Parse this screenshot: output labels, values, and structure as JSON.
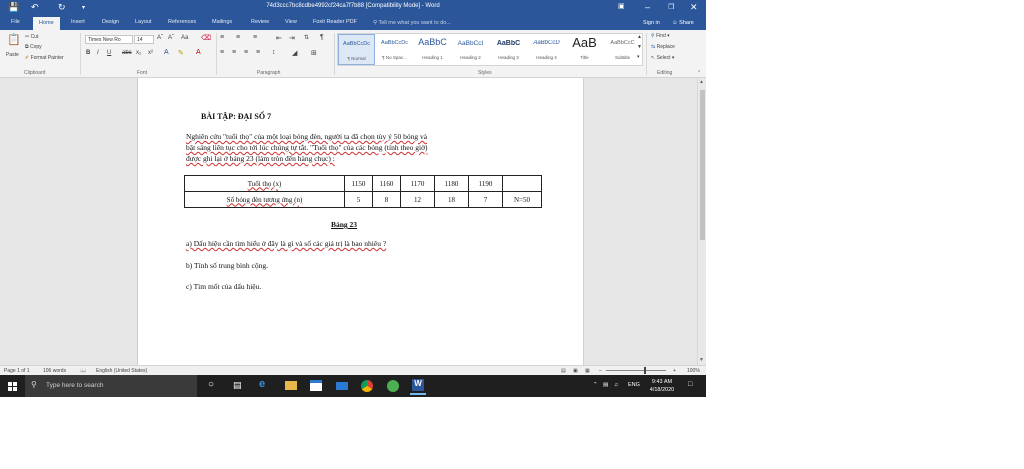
{
  "titlebar": {
    "title": "74d3ccc7bc8cdbe4992cf24ca7f7b88 [Compatibility Mode]  -  Word",
    "qa_save_icon": "save-icon",
    "qa_undo_icon": "undo-icon",
    "qa_redo_icon": "redo-icon",
    "qa_customize_icon": "chevron-down-icon",
    "window_controls": [
      "ribbon-options-icon",
      "minimize-icon",
      "restore-icon",
      "close-icon"
    ]
  },
  "tabs": [
    "File",
    "Home",
    "Insert",
    "Design",
    "Layout",
    "References",
    "Mailings",
    "Review",
    "View",
    "Foxit Reader PDF"
  ],
  "active_tab": "Home",
  "tell_me_placeholder": "Tell me what you want to do...",
  "signin_label": "Sign in",
  "share_label": "Share",
  "ribbon": {
    "clipboard": {
      "paste": "Paste",
      "cut": "Cut",
      "copy": "Copy",
      "format_painter": "Format Painter",
      "group": "Clipboard"
    },
    "font": {
      "font_name": "Times New Ro",
      "font_size": "14",
      "group": "Font"
    },
    "paragraph": {
      "group": "Paragraph"
    },
    "styles": {
      "group": "Styles",
      "items": [
        {
          "sample": "AaBbCcDc",
          "name": "¶ Normal"
        },
        {
          "sample": "AaBbCcDc",
          "name": "¶ No Spac..."
        },
        {
          "sample": "AaBbC",
          "name": "Heading 1"
        },
        {
          "sample": "AaBbCcI",
          "name": "Heading 2"
        },
        {
          "sample": "AaBbC",
          "name": "Heading 3"
        },
        {
          "sample": "AaBbCcD",
          "name": "Heading 4"
        },
        {
          "sample": "AaB",
          "name": "Title"
        },
        {
          "sample": "AaBbCcC",
          "name": "Subtitle"
        }
      ]
    },
    "editing": {
      "find": "Find",
      "replace": "Replace",
      "select": "Select",
      "group": "Editing"
    }
  },
  "document": {
    "title": "BÀI TẬP: ĐẠI SỐ 7",
    "intro_lines": [
      "Nghiên cứu \"tuổi thọ\" của một loại bóng đèn, người ta đã chọn tùy ý 50 bóng và",
      "bật sáng liên tục cho tới lúc chúng tự tắt. \"Tuổi thọ\" của các bóng (tính theo giờ)",
      "được ghi lại ở bảng 23 (làm tròn đến hàng chục) :"
    ],
    "table": {
      "row1": [
        "Tuổi thọ (x)",
        "1150",
        "1160",
        "1170",
        "1180",
        "1190",
        ""
      ],
      "row2": [
        "Số bóng đèn tương ứng (n)",
        "5",
        "8",
        "12",
        "18",
        "7",
        "N=50"
      ]
    },
    "caption": "Bảng 23",
    "questions": [
      "a) Dấu hiệu cần tìm hiểu ở đây là gì và số các giá trị là bao nhiêu ?",
      "b) Tính số trung bình cộng.",
      "c) Tìm mốt của dấu hiệu."
    ]
  },
  "statusbar": {
    "page": "Page 1 of 1",
    "words": "106 words",
    "language": "English (United States)",
    "zoom": "100%",
    "zoom_level_fraction": 0.63
  },
  "taskbar": {
    "search_placeholder": "Type here to search",
    "apps": [
      "task-view-icon",
      "edge-icon",
      "file-explorer-icon",
      "store-icon",
      "mail-icon",
      "chrome-icon",
      "photos-icon",
      "word-icon"
    ],
    "language": "ENG",
    "time": "9:43 AM",
    "date": "4/18/2020"
  }
}
